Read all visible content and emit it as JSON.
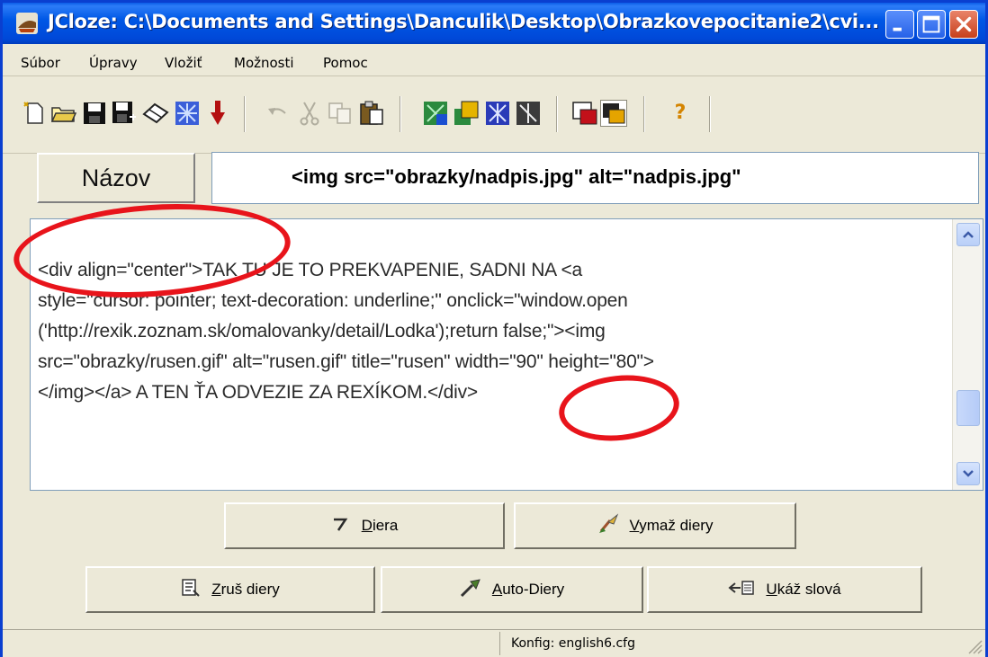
{
  "window": {
    "title": "JCloze: C:\\Documents and Settings\\Danculik\\Desktop\\Obrazkovepocitanie2\\cvi..."
  },
  "menu": {
    "items": [
      {
        "label": "Súbor"
      },
      {
        "label": "Úpravy"
      },
      {
        "label": "Vložiť"
      },
      {
        "label": "Možnosti"
      },
      {
        "label": "Pomoc"
      }
    ]
  },
  "toolbar": {
    "icons": [
      "new-file-icon",
      "open-folder-icon",
      "save-icon",
      "save-as-icon",
      "eraser-icon",
      "web-export-icon",
      "insert-pin-icon",
      "undo-icon",
      "cut-icon",
      "copy-icon",
      "paste-icon",
      "export-html-icon",
      "export-drag-drop-icon",
      "export-web-icon",
      "export-zip-icon",
      "add-picture-icon",
      "add-picture-drop-icon",
      "help-icon"
    ]
  },
  "title_field": {
    "label": "Názov",
    "value": "<img src=\"obrazky/nadpis.jpg\" alt=\"nadpis.jpg\""
  },
  "editor": {
    "lines": [
      "<div align=\"center\">TAK TU JE TO PREKVAPENIE, SADNI NA <a",
      "style=\"cursor: pointer; text-decoration: underline;\" onclick=\"window.open",
      "('http://rexik.zoznam.sk/omalovanky/detail/Lodka');return false;\"><img",
      "src=\"obrazky/rusen.gif\" alt=\"rusen.gif\" title=\"rusen\" width=\"90\" height=\"80\">",
      "</img></a> A TEN ŤA ODVEZIE ZA REXÍKOM.</div>"
    ]
  },
  "buttons": {
    "gap": {
      "label": "Diera",
      "hotkey": "D",
      "rest": "iera",
      "icon": "gap-icon"
    },
    "clear_gaps": {
      "label": "Vymaž diery",
      "hotkey": "V",
      "rest": "ymaž diery",
      "icon": "brush-icon"
    },
    "cancel_gaps": {
      "label": "Zruš diery",
      "hotkey": "Z",
      "rest": "ruš diery",
      "icon": "list-icon"
    },
    "auto_gaps": {
      "label": "Auto-Diery",
      "hotkey": "A",
      "rest": "uto-Diery",
      "icon": "wand-icon"
    },
    "show_words": {
      "label": "Ukáž slová",
      "hotkey": "U",
      "rest": "káž slová",
      "icon": "arrow-list-icon"
    }
  },
  "status": {
    "config": "Konfig: english6.cfg"
  },
  "colors": {
    "titlebar": "#0058e6",
    "annotation": "#e8141b",
    "face": "#ece9d8"
  }
}
